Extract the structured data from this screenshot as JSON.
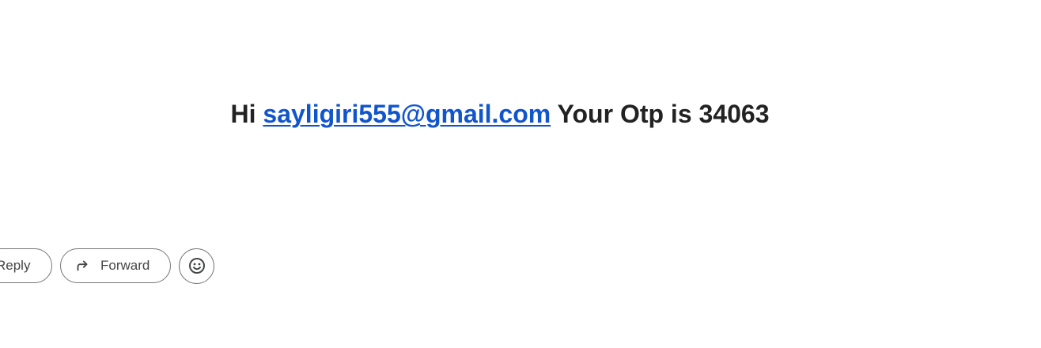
{
  "message": {
    "greeting": "Hi",
    "email": "sayligiri555@gmail.com",
    "otp_text": "Your Otp is 34063"
  },
  "actions": {
    "reply_label": "Reply",
    "forward_label": "Forward",
    "emoji_icon": "add-reaction-icon",
    "forward_icon": "forward-arrow-icon"
  },
  "colors": {
    "link": "#1155cc",
    "text": "#222222",
    "button_border": "#747775",
    "button_text": "#444746"
  }
}
